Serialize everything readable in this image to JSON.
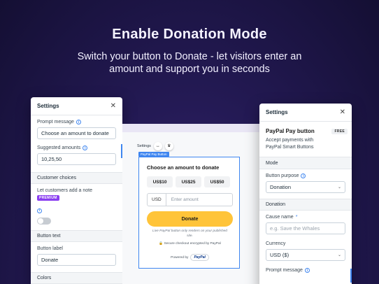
{
  "hero": {
    "title": "Enable Donation Mode",
    "subtitle": "Switch your button to Donate - let visitors enter an amount and support you in seconds"
  },
  "left_panel": {
    "title": "Settings",
    "close_icon": "close-icon",
    "prompt_message_label": "Prompt message",
    "prompt_message_value": "Choose an amount to donate",
    "suggested_amounts_label": "Suggested amounts",
    "suggested_amounts_value": "10,25,50",
    "customer_choices_section": "Customer choices",
    "add_note_label": "Let customers add a note",
    "premium_badge": "PREMIUM",
    "add_note_enabled": false,
    "button_text_section": "Button text",
    "button_label_label": "Button label",
    "button_label_value": "Donate",
    "colors_section": "Colors"
  },
  "canvas": {
    "toolbar_label": "Settings",
    "widget_tag": "PayPal Pay Button",
    "widget_title": "Choose an amount to donate",
    "amounts": [
      "US$10",
      "US$25",
      "US$50"
    ],
    "currency_code": "USD",
    "amount_placeholder": "Enter amount",
    "donate_label": "Donate",
    "note": "Live PayPal button only renders on your published site.",
    "secure_text": "Secure checkout encrypted by PayPal",
    "powered_by": "Powered by",
    "paypal_logo": "PayPal"
  },
  "right_panel": {
    "title": "Settings",
    "brand_title": "PayPal Pay button",
    "brand_desc": "Accept payments with PayPal Smart Buttons",
    "free_badge": "FREE",
    "mode_section": "Mode",
    "button_purpose_label": "Button purpose",
    "button_purpose_value": "Donation",
    "donation_section": "Donation",
    "cause_name_label": "Cause name",
    "cause_name_required": "*",
    "cause_name_placeholder": "e.g. Save the Whales",
    "currency_label": "Currency",
    "currency_value": "USD ($)",
    "prompt_message_label": "Prompt message"
  },
  "colors": {
    "accent": "#3f86f0",
    "paypal_yellow": "#ffc439",
    "premium": "#8a3ff0"
  }
}
